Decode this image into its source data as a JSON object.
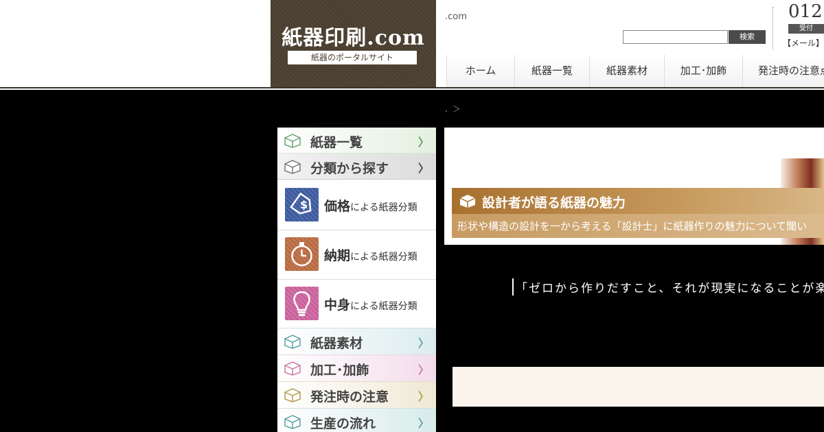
{
  "header": {
    "logo_title": "紙器印刷.com",
    "logo_subtitle": "紙器のポータルサイト",
    "domain_text": ".com",
    "search": {
      "placeholder": "",
      "button_label": "検索"
    },
    "phone": "012",
    "hours_label": "受付",
    "mail_label": "【メール】"
  },
  "nav": {
    "items": [
      {
        "label": "ホーム"
      },
      {
        "label": "紙器一覧"
      },
      {
        "label": "紙器素材"
      },
      {
        "label": "加工･加飾"
      },
      {
        "label": "発注時の注意点"
      }
    ]
  },
  "breadcrumb": {
    "text": "．＞"
  },
  "sidebar": {
    "top_items": [
      {
        "label": "紙器一覧",
        "chevron": "〉",
        "color": "#5e9a5a"
      },
      {
        "label": "分類から探す",
        "chevron": "〉",
        "color": "#444444"
      }
    ],
    "categories": [
      {
        "main": "価格",
        "rest": "による紙器分類",
        "icon": "price-tag-icon",
        "color": "#3d5a9e"
      },
      {
        "main": "納期",
        "rest": "による紙器分類",
        "icon": "stopwatch-icon",
        "color": "#b86a40"
      },
      {
        "main": "中身",
        "rest": "による紙器分類",
        "icon": "light-bulb-icon",
        "color": "#c9609b"
      }
    ],
    "bottom_items": [
      {
        "label": "紙器素材",
        "chevron": "〉",
        "color": "#5aa0a8"
      },
      {
        "label": "加工･加飾",
        "chevron": "〉",
        "color": "#c979a8"
      },
      {
        "label": "発注時の注意",
        "chevron": "〉",
        "color": "#b49a4e"
      },
      {
        "label": "生産の流れ",
        "chevron": "〉",
        "color": "#5aa0a0"
      }
    ]
  },
  "feature": {
    "title": "設計者が語る紙器の魅力",
    "subtitle": "形状や構造の設計を一から考える「設計士」に紙器作りの魅力について聞い"
  },
  "quote": {
    "text": "「ゼロから作りだすこと、それが現実になることが楽"
  }
}
